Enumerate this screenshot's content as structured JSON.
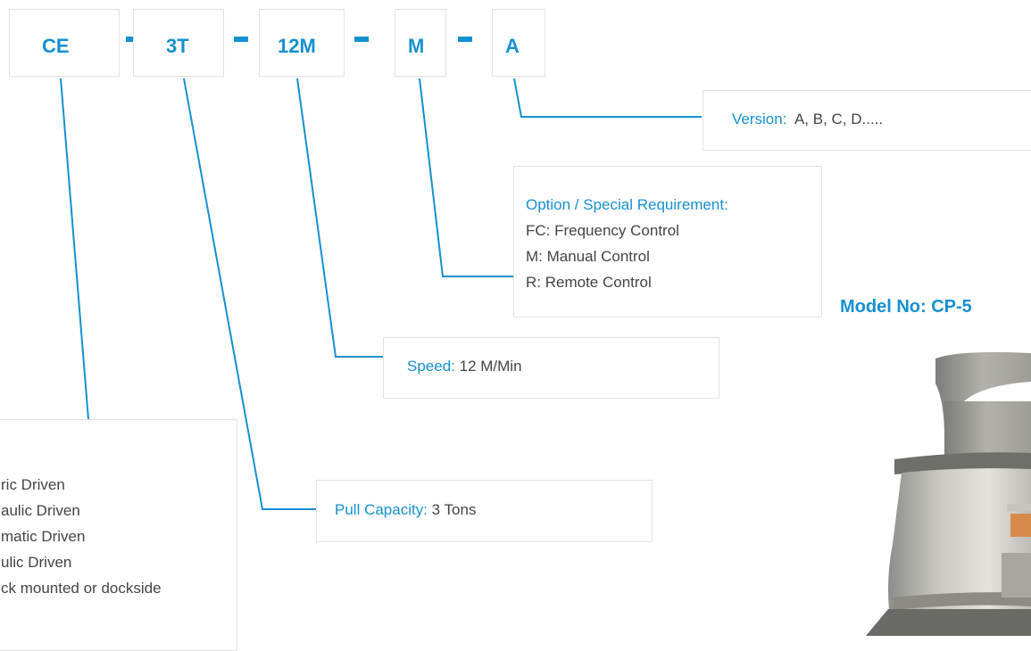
{
  "codes": [
    "CE",
    "3T",
    "12M",
    "M",
    "A"
  ],
  "version": {
    "label": "Version:",
    "value": "A, B, C, D....."
  },
  "option": {
    "title": "Option / Special Requirement:",
    "items": [
      "FC: Frequency Control",
      "M: Manual Control",
      "R: Remote Control"
    ]
  },
  "speed": {
    "label": "Speed:",
    "value": "12 M/Min"
  },
  "pull": {
    "label": "Pull Capacity:",
    "value": "3 Tons"
  },
  "drive_items": [
    "ric Driven",
    "aulic Driven",
    "matic Driven",
    "ulic Driven",
    "ck mounted or dockside"
  ],
  "model": {
    "title": "Model No: CP-5"
  },
  "colors": {
    "accent": "#1590d0",
    "border": "#e2e2e2",
    "text": "#444444"
  }
}
